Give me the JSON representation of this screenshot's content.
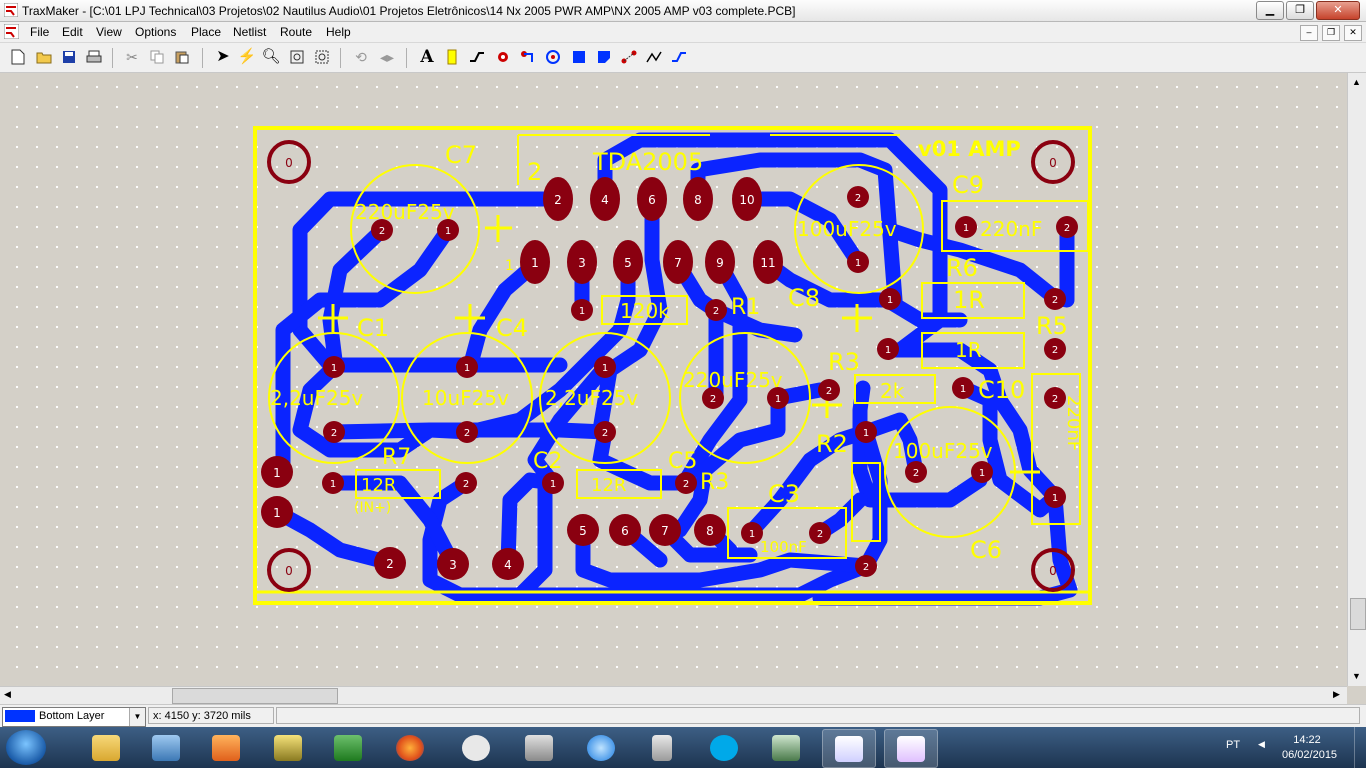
{
  "window": {
    "title": "TraxMaker - [C:\\01 LPJ Technical\\03 Projetos\\02 Nautilus Audio\\01 Projetos Eletrônicos\\14 Nx 2005 PWR AMP\\NX 2005 AMP v03 complete.PCB]",
    "minimize": "▁",
    "maximize": "❐",
    "close": "✕"
  },
  "menu": {
    "items": [
      "File",
      "Edit",
      "View",
      "Options",
      "Place",
      "Netlist",
      "Route",
      "Help"
    ]
  },
  "toolbar": {
    "icons": [
      "new-file-icon",
      "open-folder-icon",
      "save-icon",
      "print-icon",
      "cut-icon",
      "copy-icon",
      "paste-icon",
      "select-arrow-icon",
      "autoroute-icon",
      "zoom-icon",
      "zoom-fit-icon",
      "zoom-area-icon",
      "rotate-icon",
      "mirror-icon",
      "text-icon",
      "component-icon",
      "track-icon",
      "pad-icon",
      "via-icon",
      "arc-icon",
      "fill-icon",
      "polygon-icon",
      "connection-icon",
      "route-icon",
      "trace-icon"
    ]
  },
  "pcb": {
    "colors": {
      "board_outline": "#ffff00",
      "copper_bottom": "#0b24ff",
      "pad": "#8a0010",
      "pad_text": "#ffffff",
      "background": "#d4d0c8"
    },
    "silk_labels": [
      "C7",
      "TDA2005",
      "v01 AMP",
      "C9",
      "220nF",
      "R6",
      "1R",
      "R5",
      "C8",
      "R1",
      "120k",
      "C1",
      "C4",
      "R3",
      "2k",
      "C10",
      "R2",
      "100uF25v",
      "C2",
      "C5",
      "R7",
      "12R",
      "(IN+)",
      "C3",
      "100nF",
      "C6",
      "220uF25v",
      "2,2uF25v",
      "10uF25v",
      "220uF25v",
      "100uF25v",
      "2,2uF25v",
      "12R",
      "1R",
      "220nF",
      "2",
      "1"
    ],
    "pad_labels": [
      "0",
      "0",
      "0",
      "0",
      "1",
      "2",
      "3",
      "4",
      "5",
      "6",
      "7",
      "8",
      "9",
      "10",
      "11"
    ]
  },
  "status": {
    "layer": "Bottom Layer",
    "layer_color": "#0033ff",
    "coords": "x: 4150   y: 3720   mils"
  },
  "taskbar": {
    "apps": [
      "file-explorer",
      "remote-desktop",
      "media-player",
      "sigma-app",
      "excel",
      "firefox",
      "clock-app",
      "ab-app",
      "internet-explorer",
      "calculator",
      "skype",
      "monitor-app",
      "schematic-app",
      "traxmaker"
    ],
    "language": "PT",
    "time": "14:22",
    "date": "06/02/2015"
  }
}
